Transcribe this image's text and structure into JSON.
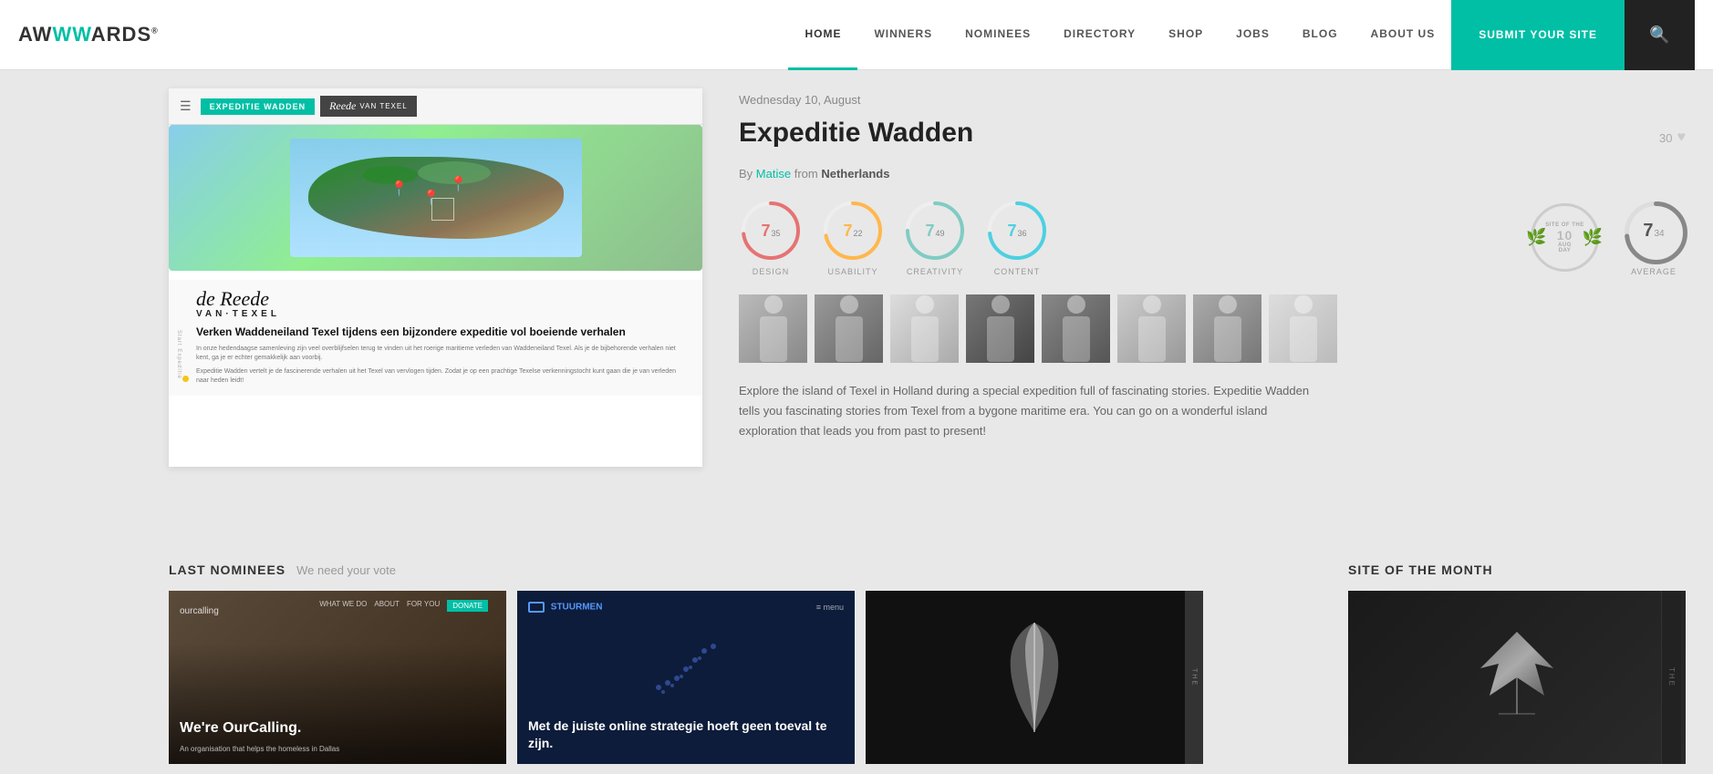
{
  "nav": {
    "logo": "AWWWARDS",
    "logo_reg": "®",
    "links": [
      {
        "label": "HOME",
        "active": true
      },
      {
        "label": "WINNERS",
        "active": false
      },
      {
        "label": "NOMINEES",
        "active": false
      },
      {
        "label": "DIRECTORY",
        "active": false
      },
      {
        "label": "SHOP",
        "active": false
      },
      {
        "label": "JOBS",
        "active": false
      },
      {
        "label": "BLOG",
        "active": false
      },
      {
        "label": "ABOUT US",
        "active": false
      }
    ],
    "submit_label": "SUBMIT YOUR SITE",
    "search_placeholder": "Search"
  },
  "featured": {
    "date": "Wednesday 10, August",
    "title": "Expeditie Wadden",
    "author": "Matise",
    "from_label": "from",
    "country": "Netherlands",
    "heart_count": "30",
    "scores": {
      "design": {
        "value": "7",
        "decimal": "35",
        "label": "DESIGN",
        "color": "#e57373",
        "pct": 73.5
      },
      "usability": {
        "value": "7",
        "decimal": "22",
        "label": "USABILITY",
        "color": "#ffb74d",
        "pct": 72.2
      },
      "creativity": {
        "value": "7",
        "decimal": "49",
        "label": "CREATIVITY",
        "color": "#80cbc4",
        "pct": 74.9
      },
      "content": {
        "value": "7",
        "decimal": "36",
        "label": "CONTENT",
        "color": "#4dd0e1",
        "pct": 73.6
      },
      "sotd": {
        "label": "SITE OF THE\nDAY",
        "date": "10",
        "month": "AUG"
      },
      "average": {
        "value": "7",
        "decimal": "34",
        "label": "AVERAGE",
        "color": "#888",
        "pct": 73.4
      }
    },
    "description": "Explore the island of Texel in Holland during a special expedition full of fascinating stories. Expeditie Wadden tells you fascinating stories from Texel from a bygone maritime era. You can go on a wonderful island exploration that leads you from past to present!",
    "preview": {
      "tab1": "EXPEDITIE WADDEN",
      "tab2": "Reede VAN TEXEL",
      "heading1": "de",
      "heading2": "Reede",
      "heading3": "VAN TEXEL",
      "body_heading": "Verken Waddeneiland Texel tijdens een bijzondere expeditie vol boeiende verhalen",
      "body_text1": "In onze hedendaagse samenleving zijn veel overblijfselen terug te vinden uit het roerige maritieme verleden van Waddeneiland Texel. Als je de bijbehorende verhalen niet kent, ga je er echter gemakkelijk aan voorbij.",
      "body_text2": "Expeditie Wadden vertelt je de fascinerende verhalen uit het Texel van vervlogen tijden. Zodat je op een prachtige Texelse verkenningstocht kunt gaan die je van verleden naar heden leidt!"
    }
  },
  "nominees": {
    "section_title": "LAST NOMINEES",
    "subtitle": "We need your vote",
    "cards": [
      {
        "title": "We're OurCalling.",
        "sub": "An organisation that helps the homeless in Dallas",
        "theme": "dark-photo"
      },
      {
        "title": "Met de juiste online strategie hoeft geen toeval te zijn.",
        "theme": "navy"
      },
      {
        "title": "",
        "theme": "black"
      }
    ]
  },
  "sotm": {
    "section_title": "SITE OF THE MONTH"
  }
}
